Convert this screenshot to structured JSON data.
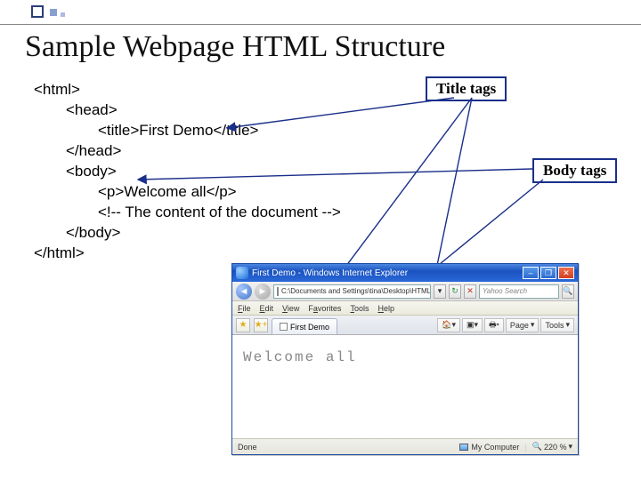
{
  "slide": {
    "title": "Sample Webpage HTML Structure"
  },
  "labels": {
    "title_tags": "Title tags",
    "body_tags": "Body tags"
  },
  "code": {
    "l1": "<html>",
    "l2": "<head>",
    "l3": "<title>First Demo</title>",
    "l4": "</head>",
    "l5": "<body>",
    "l6": "<p>Welcome all</p>",
    "l7": "<!-- The content of the document -->",
    "l8": "</body>",
    "l9": "</html>"
  },
  "browser": {
    "window_title": "First Demo - Windows Internet Explorer",
    "address": "C:\\Documents and Settings\\tina\\Desktop\\HTML_Wo...",
    "search_placeholder": "Yahoo Search",
    "menu": {
      "file": "File",
      "edit": "Edit",
      "view": "View",
      "favorites": "Favorites",
      "tools": "Tools",
      "help": "Help"
    },
    "tab_label": "First Demo",
    "toolbar": {
      "page": "Page",
      "tools": "Tools"
    },
    "page_text": "Welcome all",
    "status_left": "Done",
    "zone": "My Computer",
    "zoom": "220 %"
  }
}
